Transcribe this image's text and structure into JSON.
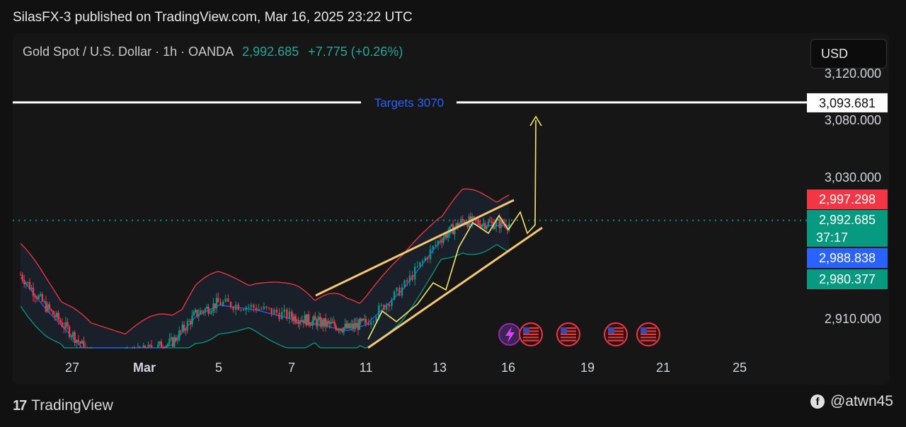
{
  "header": {
    "text": "SilasFX-3 published on TradingView.com, Mar 16, 2025 23:22 UTC"
  },
  "symbol": {
    "name": "Gold Spot / U.S. Dollar · 1h · OANDA",
    "price": "2,992.685",
    "change": "+7.775 (+0.26%)"
  },
  "currency": "USD",
  "annotation": {
    "target_label": "Targets 3070",
    "target_price": "3,093.681"
  },
  "price_tags": [
    {
      "label": "2,997.298",
      "color": "#f23645"
    },
    {
      "label": "2,992.685",
      "sub": "37:17",
      "color": "#089981"
    },
    {
      "label": "2,988.838",
      "color": "#2962ff"
    },
    {
      "label": "2,980.377",
      "color": "#089981"
    }
  ],
  "footer": {
    "brand": "TradingView",
    "handle": "@atwn45"
  },
  "colors": {
    "up": "#089981",
    "down": "#f23645",
    "band_upper": "#f23645",
    "band_lower": "#089981",
    "band_mid": "#2962ff",
    "channel": "#f7c873",
    "projection": "#f5e66b"
  },
  "chart_data": {
    "type": "line",
    "instrument": "Gold Spot / U.S. Dollar",
    "timeframe": "1h",
    "x_ticks": [
      "27",
      "Mar",
      "5",
      "7",
      "11",
      "13",
      "16",
      "19",
      "21",
      "25"
    ],
    "y_ticks": [
      "3,120.000",
      "3,080.000",
      "3,030.000",
      "2,910.000"
    ],
    "y_range": [
      2880,
      3130
    ],
    "price_series": [
      {
        "x": "Feb 25",
        "y": 2946
      },
      {
        "x": "Feb 26",
        "y": 2918
      },
      {
        "x": "Feb 27",
        "y": 2895
      },
      {
        "x": "Feb 28",
        "y": 2870
      },
      {
        "x": "Mar 3",
        "y": 2888
      },
      {
        "x": "Mar 4",
        "y": 2912
      },
      {
        "x": "Mar 5",
        "y": 2922
      },
      {
        "x": "Mar 6",
        "y": 2918
      },
      {
        "x": "Mar 7",
        "y": 2910
      },
      {
        "x": "Mar 10",
        "y": 2900
      },
      {
        "x": "Mar 11",
        "y": 2905
      },
      {
        "x": "Mar 12",
        "y": 2935
      },
      {
        "x": "Mar 13",
        "y": 2976
      },
      {
        "x": "Mar 14",
        "y": 2992
      },
      {
        "x": "Mar 15",
        "y": 2990
      }
    ],
    "levels": [
      {
        "label": "Targets 3070",
        "price": 3093.681
      },
      {
        "label": "current",
        "price": 2992.685
      }
    ],
    "price_tags": [
      2997.298,
      2992.685,
      2988.838,
      2980.377
    ]
  }
}
